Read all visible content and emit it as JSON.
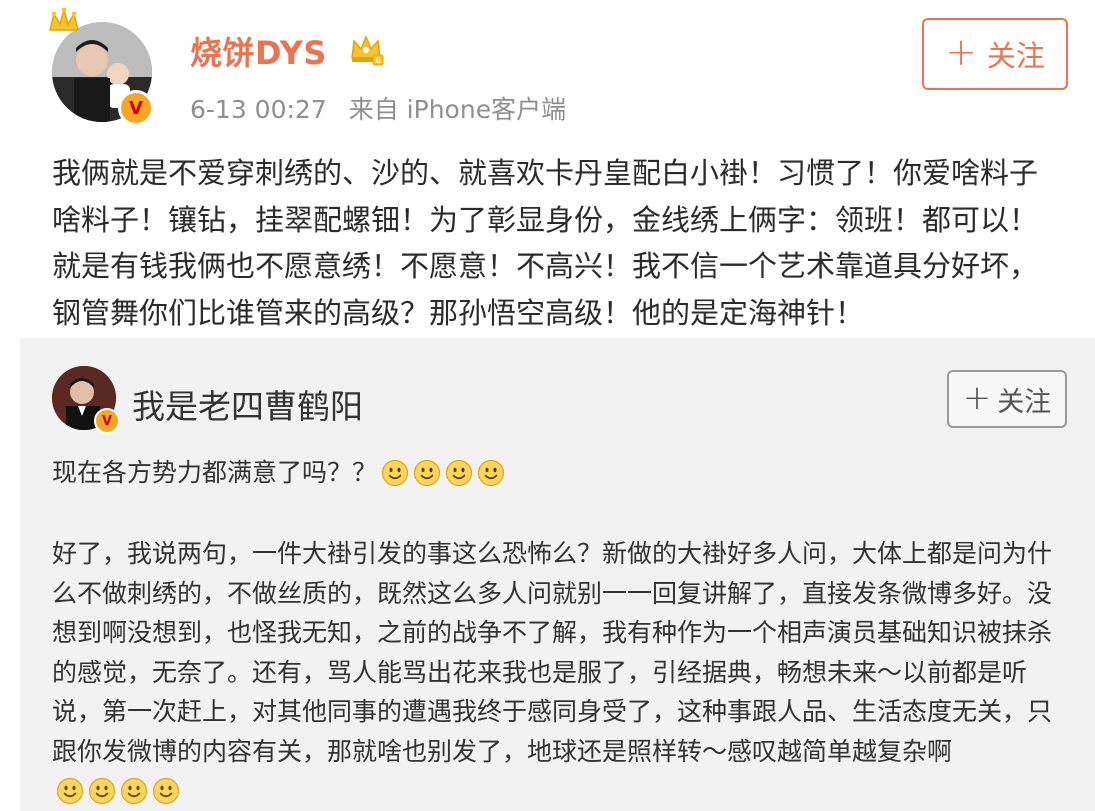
{
  "post": {
    "username": "烧饼DYS",
    "time": "6-13 00:27",
    "source": "来自 iPhone客户端",
    "follow_label": "关注",
    "text": "我俩就是不爱穿刺绣的、沙的、就喜欢卡丹皇配白小褂！习惯了！你爱啥料子啥料子！镶钻，挂翠配螺钿！为了彰显身份，金线绣上俩字：领班！都可以！就是有钱我俩也不愿意绣！不愿意！不高兴！我不信一个艺术靠道具分好坏，钢管舞你们比谁管来的高级？那孙悟空高级！他的是定海神针！"
  },
  "repost": {
    "username": "我是老四曹鹤阳",
    "follow_label": "关注",
    "question": "现在各方势力都满意了吗？？",
    "body": "好了，我说两句，一件大褂引发的事这么恐怖么？新做的大褂好多人问，大体上都是问为什么不做刺绣的，不做丝质的，既然这么多人问就别一一回复讲解了，直接发条微博多好。没想到啊没想到，也怪我无知，之前的战争不了解，我有种作为一个相声演员基础知识被抹杀的感觉，无奈了。还有，骂人能骂出花来我也是服了，引经据典，畅想未来～以前都是听说，第一次赶上，对其他同事的遭遇我终于感同身受了，这种事跟人品、生活态度无关，只跟你发微博的内容有关，那就啥也别发了，地球还是照样转～感叹越简单越复杂啊"
  },
  "colors": {
    "accent": "#eb7350",
    "repost_bg": "#f2f2f2",
    "meta_gray": "#8f8f8f"
  },
  "icons": {
    "verified_badge": "verified-v-badge-icon",
    "member_crown": "vip-crown-icon",
    "smiley": "smiley-emoji-icon"
  }
}
